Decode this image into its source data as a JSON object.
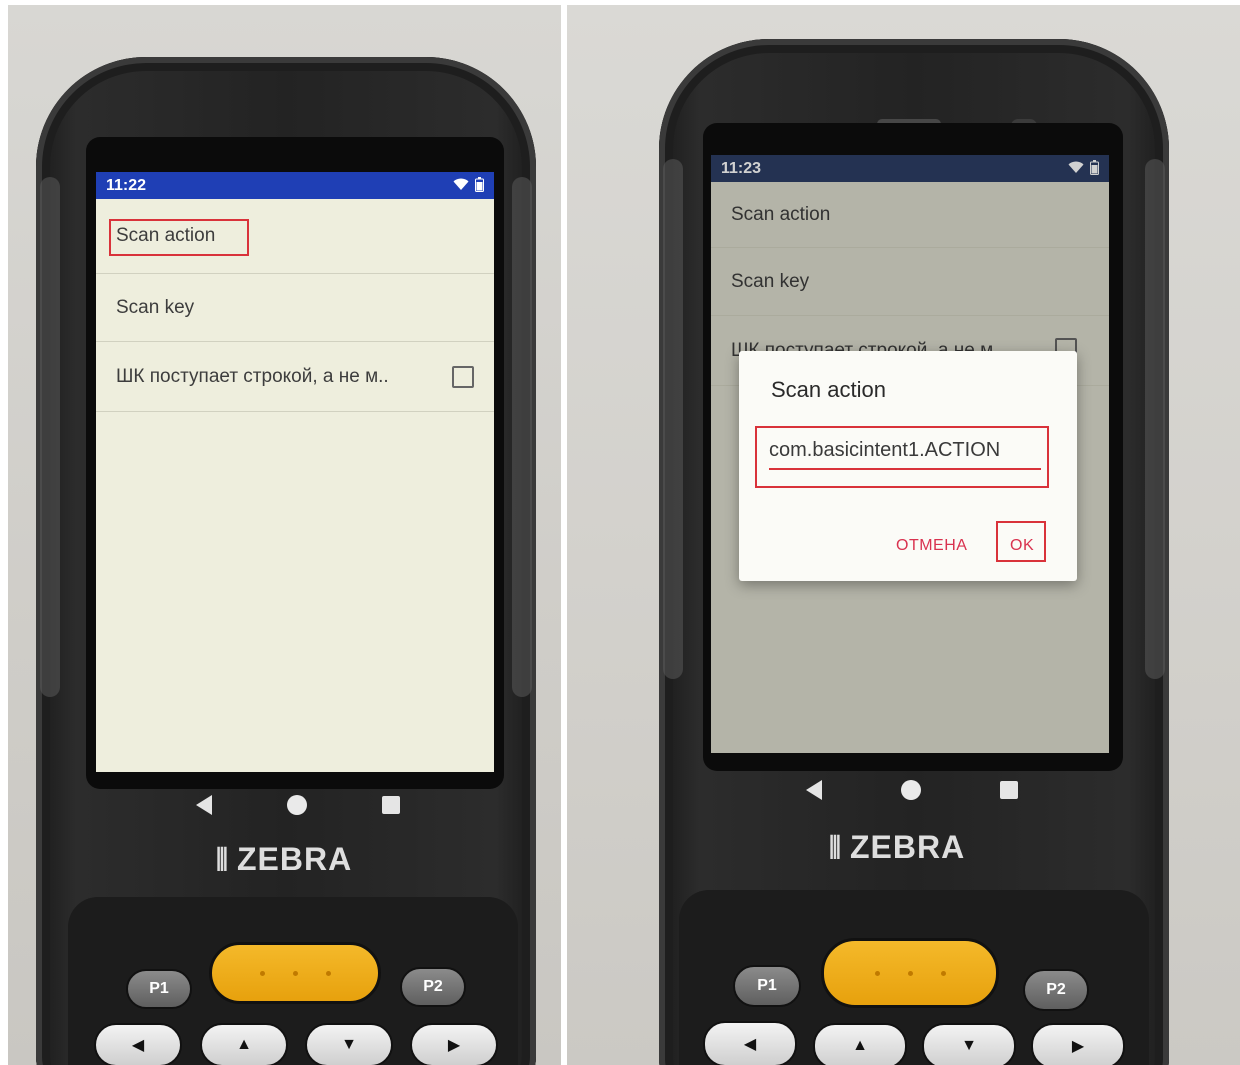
{
  "left_screen": {
    "status_time": "11:22",
    "items": [
      {
        "label": "Scan action"
      },
      {
        "label": "Scan key"
      },
      {
        "label": "ШК поступает строкой, а не м.."
      }
    ],
    "checkbox_checked": false
  },
  "right_screen": {
    "status_time": "11:23",
    "items": [
      {
        "label": "Scan action"
      },
      {
        "label": "Scan key"
      },
      {
        "label": "ШК поступает строкой, а не м.."
      }
    ],
    "dialog": {
      "title": "Scan action",
      "input_value": "com.basicintent1.ACTION",
      "cancel_label": "ОТМЕНА",
      "ok_label": "OK"
    }
  },
  "device": {
    "brand": "ZEBRA",
    "keys": {
      "p1": "P1",
      "p2": "P2"
    }
  },
  "colors": {
    "statusbar_left": "#1f3fb5",
    "statusbar_right": "#2c3e64",
    "screen_bg": "#eeeedd",
    "highlight": "#d9323a",
    "dialog_button": "#d9324f",
    "scan_key": "#f0b01e"
  },
  "icons": [
    "wifi-icon",
    "battery-icon",
    "nav-back-icon",
    "nav-home-icon",
    "nav-recent-icon",
    "zebra-logo-icon",
    "arrow-left-icon",
    "arrow-up-icon",
    "arrow-down-icon",
    "arrow-right-icon"
  ]
}
